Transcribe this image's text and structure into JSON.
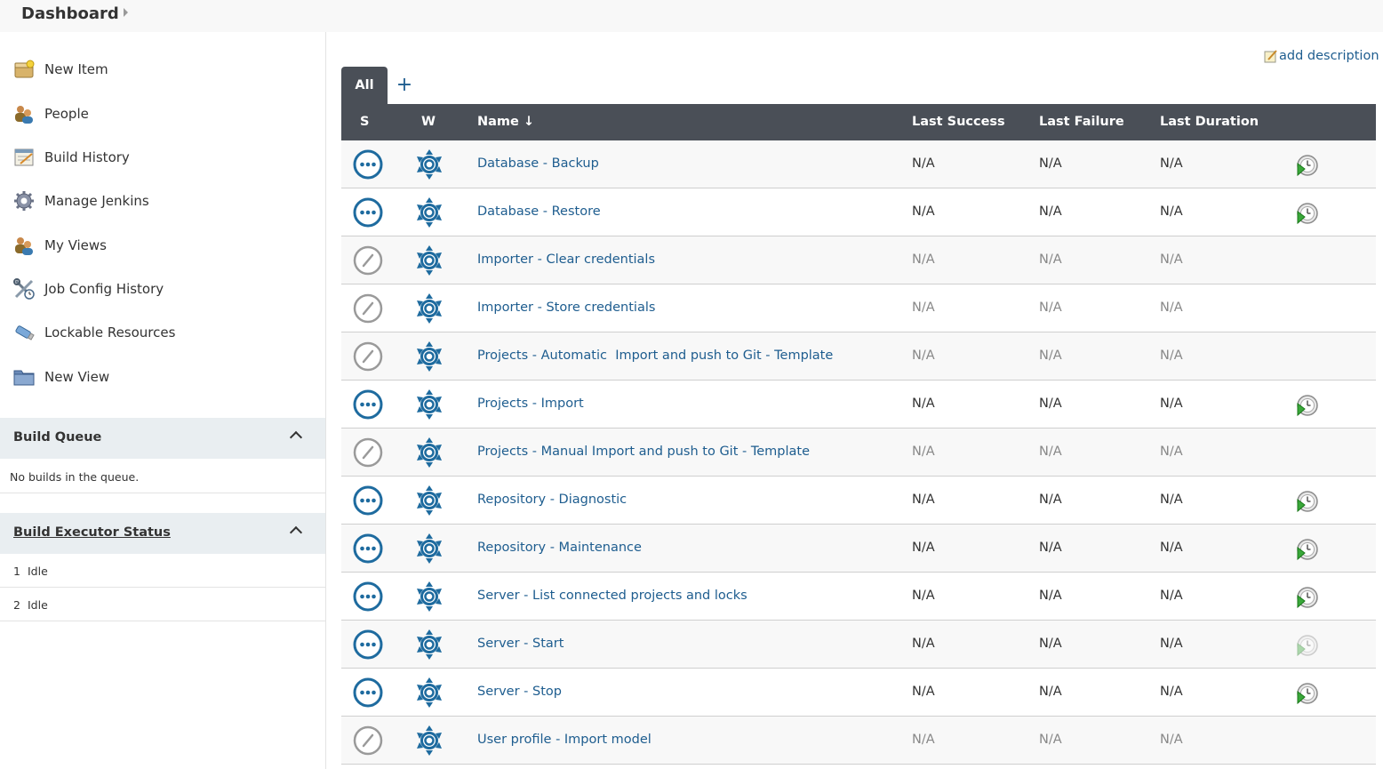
{
  "breadcrumb": {
    "root": "Dashboard"
  },
  "sidebar": {
    "tasks": [
      {
        "label": "New Item",
        "icon": "new-item-icon"
      },
      {
        "label": "People",
        "icon": "people-icon"
      },
      {
        "label": "Build History",
        "icon": "notepad-icon"
      },
      {
        "label": "Manage Jenkins",
        "icon": "gear-icon"
      },
      {
        "label": "My Views",
        "icon": "people-icon"
      },
      {
        "label": "Job Config History",
        "icon": "tools-icon"
      },
      {
        "label": "Lockable Resources",
        "icon": "usb-key-icon"
      },
      {
        "label": "New View",
        "icon": "folder-icon"
      }
    ],
    "build_queue": {
      "title": "Build Queue",
      "empty_text": "No builds in the queue."
    },
    "executors": {
      "title": "Build Executor Status",
      "rows": [
        {
          "number": "1",
          "status": "Idle"
        },
        {
          "number": "2",
          "status": "Idle"
        }
      ]
    }
  },
  "main": {
    "add_description": "add description",
    "tabs": {
      "all": "All",
      "add": "+"
    },
    "columns": {
      "s": "S",
      "w": "W",
      "name": "Name ↓",
      "last_success": "Last Success",
      "last_failure": "Last Failure",
      "last_duration": "Last Duration"
    },
    "jobs": [
      {
        "name": "Database - Backup",
        "status": "not-built",
        "last_success": "N/A",
        "last_failure": "N/A",
        "last_duration": "N/A",
        "schedule": "active"
      },
      {
        "name": "Database - Restore",
        "status": "not-built",
        "last_success": "N/A",
        "last_failure": "N/A",
        "last_duration": "N/A",
        "schedule": "active"
      },
      {
        "name": "Importer - Clear credentials",
        "status": "disabled",
        "last_success": "N/A",
        "last_failure": "N/A",
        "last_duration": "N/A",
        "schedule": "none"
      },
      {
        "name": "Importer - Store credentials",
        "status": "disabled",
        "last_success": "N/A",
        "last_failure": "N/A",
        "last_duration": "N/A",
        "schedule": "none"
      },
      {
        "name": "Projects - Automatic  Import and push to Git - Template",
        "status": "disabled",
        "last_success": "N/A",
        "last_failure": "N/A",
        "last_duration": "N/A",
        "schedule": "none"
      },
      {
        "name": "Projects - Import",
        "status": "not-built",
        "last_success": "N/A",
        "last_failure": "N/A",
        "last_duration": "N/A",
        "schedule": "active"
      },
      {
        "name": "Projects - Manual Import and push to Git - Template",
        "status": "disabled",
        "last_success": "N/A",
        "last_failure": "N/A",
        "last_duration": "N/A",
        "schedule": "none"
      },
      {
        "name": "Repository - Diagnostic",
        "status": "not-built",
        "last_success": "N/A",
        "last_failure": "N/A",
        "last_duration": "N/A",
        "schedule": "active"
      },
      {
        "name": "Repository - Maintenance",
        "status": "not-built",
        "last_success": "N/A",
        "last_failure": "N/A",
        "last_duration": "N/A",
        "schedule": "active"
      },
      {
        "name": "Server - List connected projects and locks",
        "status": "not-built",
        "last_success": "N/A",
        "last_failure": "N/A",
        "last_duration": "N/A",
        "schedule": "active"
      },
      {
        "name": "Server - Start",
        "status": "not-built",
        "last_success": "N/A",
        "last_failure": "N/A",
        "last_duration": "N/A",
        "schedule": "faded"
      },
      {
        "name": "Server - Stop",
        "status": "not-built",
        "last_success": "N/A",
        "last_failure": "N/A",
        "last_duration": "N/A",
        "schedule": "active"
      },
      {
        "name": "User profile - Import model",
        "status": "disabled",
        "last_success": "N/A",
        "last_failure": "N/A",
        "last_duration": "N/A",
        "schedule": "none"
      }
    ]
  },
  "colors": {
    "link": "#1e5d8f",
    "header_bg": "#4a4f57",
    "pane_bg": "#e9eef1",
    "status_blue": "#1e6b9f",
    "status_grey": "#9a9a9a"
  }
}
